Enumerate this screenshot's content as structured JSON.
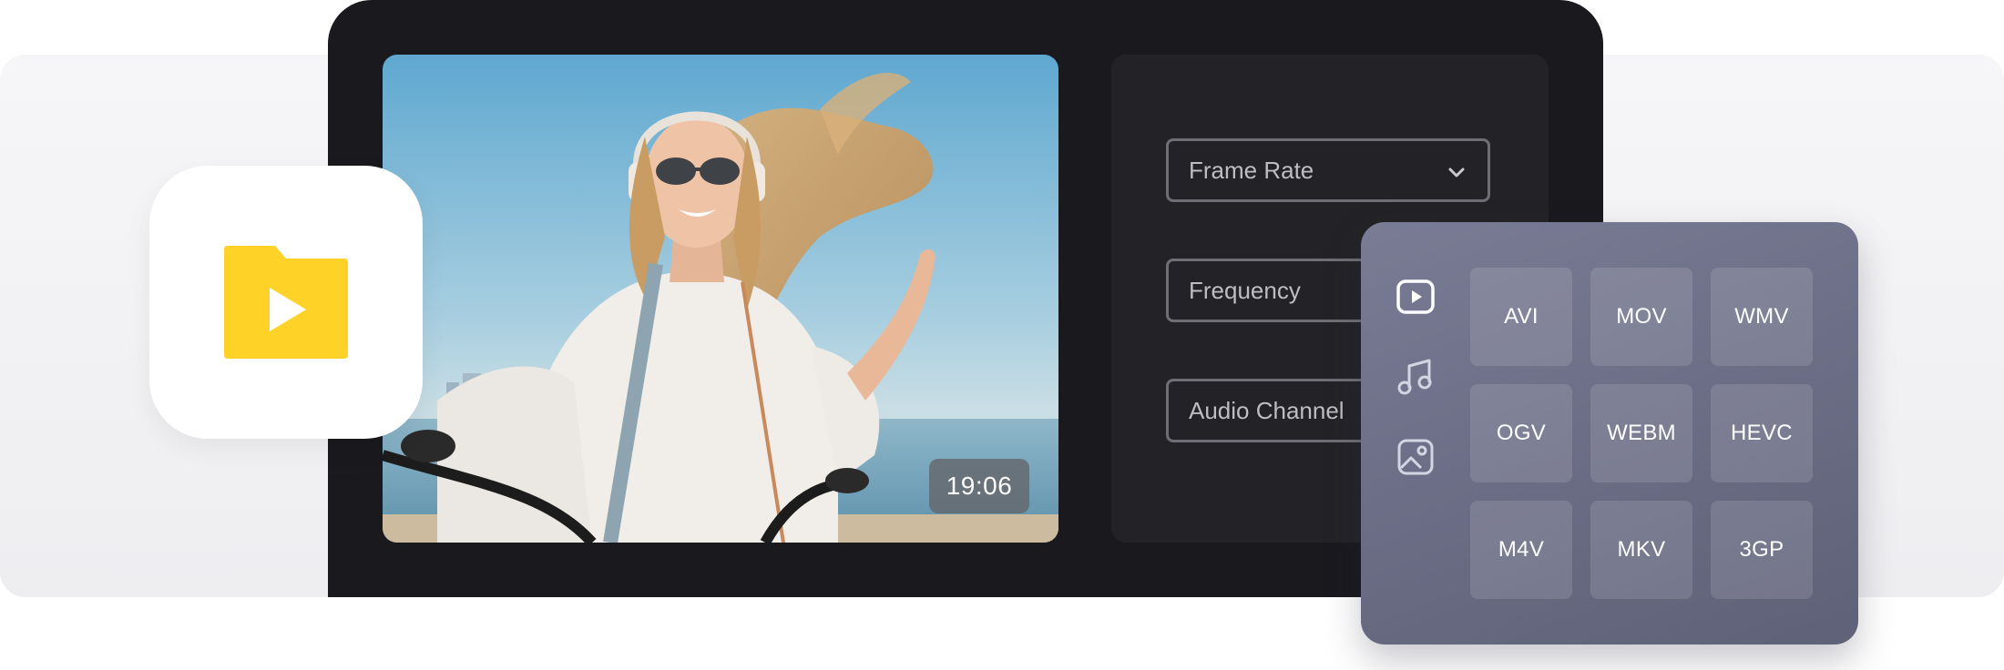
{
  "preview": {
    "timestamp": "19:06"
  },
  "settings": {
    "fields": [
      {
        "label": "Frame Rate",
        "has_dropdown": true
      },
      {
        "label": "Frequency",
        "has_dropdown": false
      },
      {
        "label": "Audio Channel",
        "has_dropdown": false
      }
    ]
  },
  "app_icon": {
    "icon": "video-folder-icon",
    "color": "#FFD228"
  },
  "formats": {
    "tabs": [
      {
        "icon": "video-icon",
        "active": true
      },
      {
        "icon": "music-icon",
        "active": false
      },
      {
        "icon": "image-icon",
        "active": false
      }
    ],
    "items": [
      "AVI",
      "MOV",
      "WMV",
      "OGV",
      "WEBM",
      "HEVC",
      "M4V",
      "MKV",
      "3GP"
    ]
  }
}
